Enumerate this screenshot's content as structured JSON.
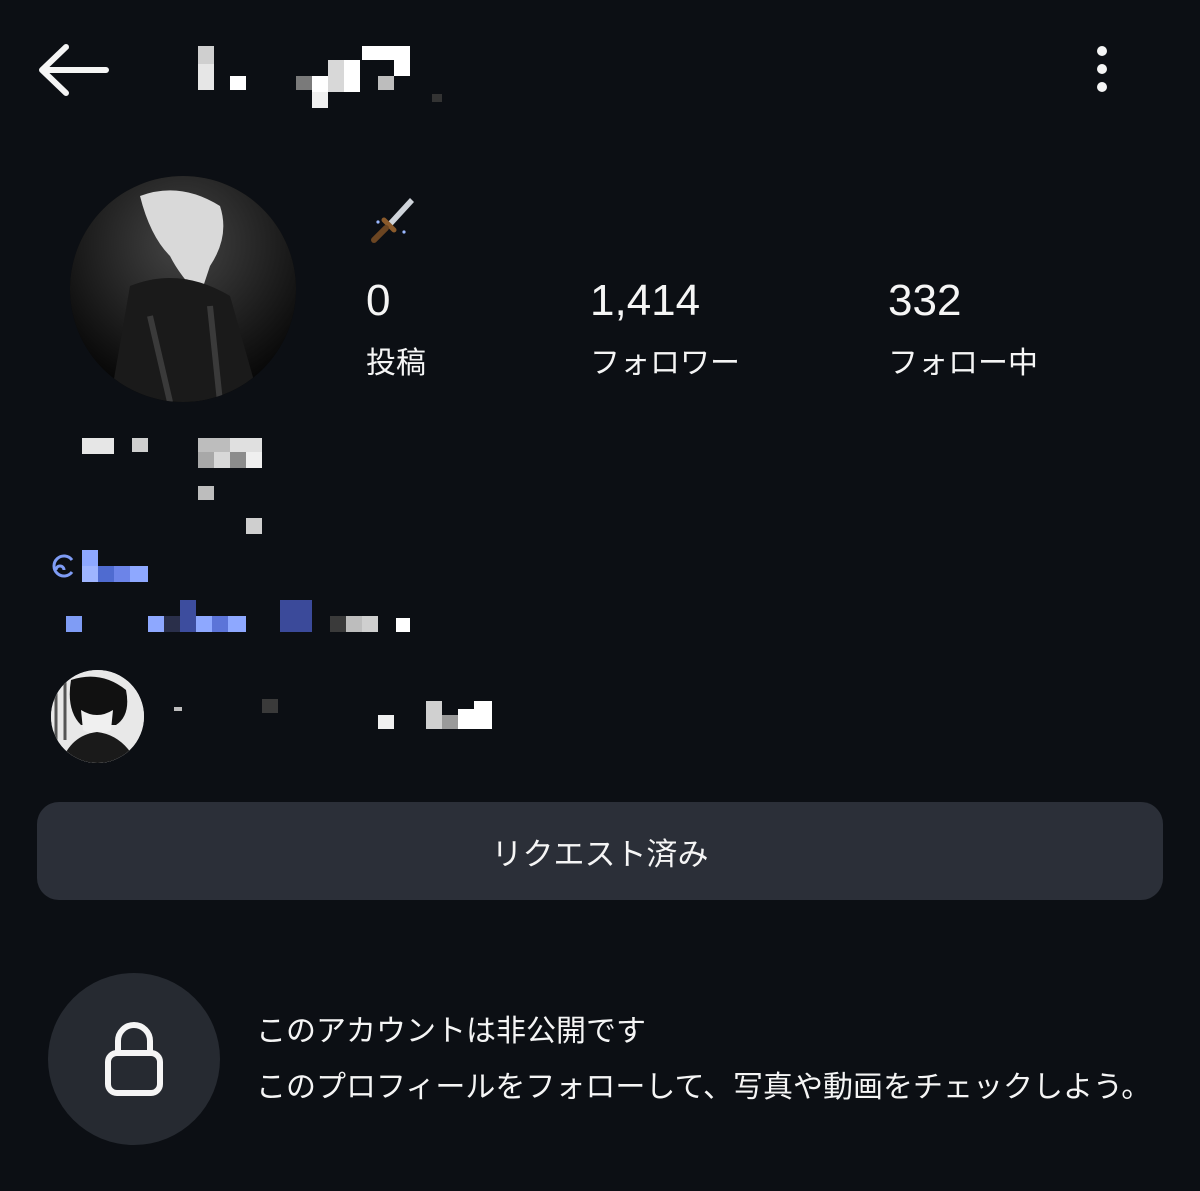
{
  "header": {
    "back_icon": "arrow-left-icon",
    "more_icon": "more-vertical-icon"
  },
  "profile": {
    "bio_emoji": "🗡️",
    "stats": [
      {
        "value": "0",
        "label": "投稿"
      },
      {
        "value": "1,414",
        "label": "フォロワー"
      },
      {
        "value": "332",
        "label": "フォロー中"
      }
    ]
  },
  "follow_button": {
    "label": "リクエスト済み"
  },
  "private_notice": {
    "icon": "lock-icon",
    "title": "このアカウントは非公開です",
    "description": "このプロフィールをフォローして、写真や動画をチェックしよう。"
  },
  "colors": {
    "background": "#0c0f14",
    "button_bg": "#2b2f38",
    "lock_circle_bg": "#262a31",
    "link_blue": "#7f9cf5",
    "text": "#f5f5f5"
  }
}
